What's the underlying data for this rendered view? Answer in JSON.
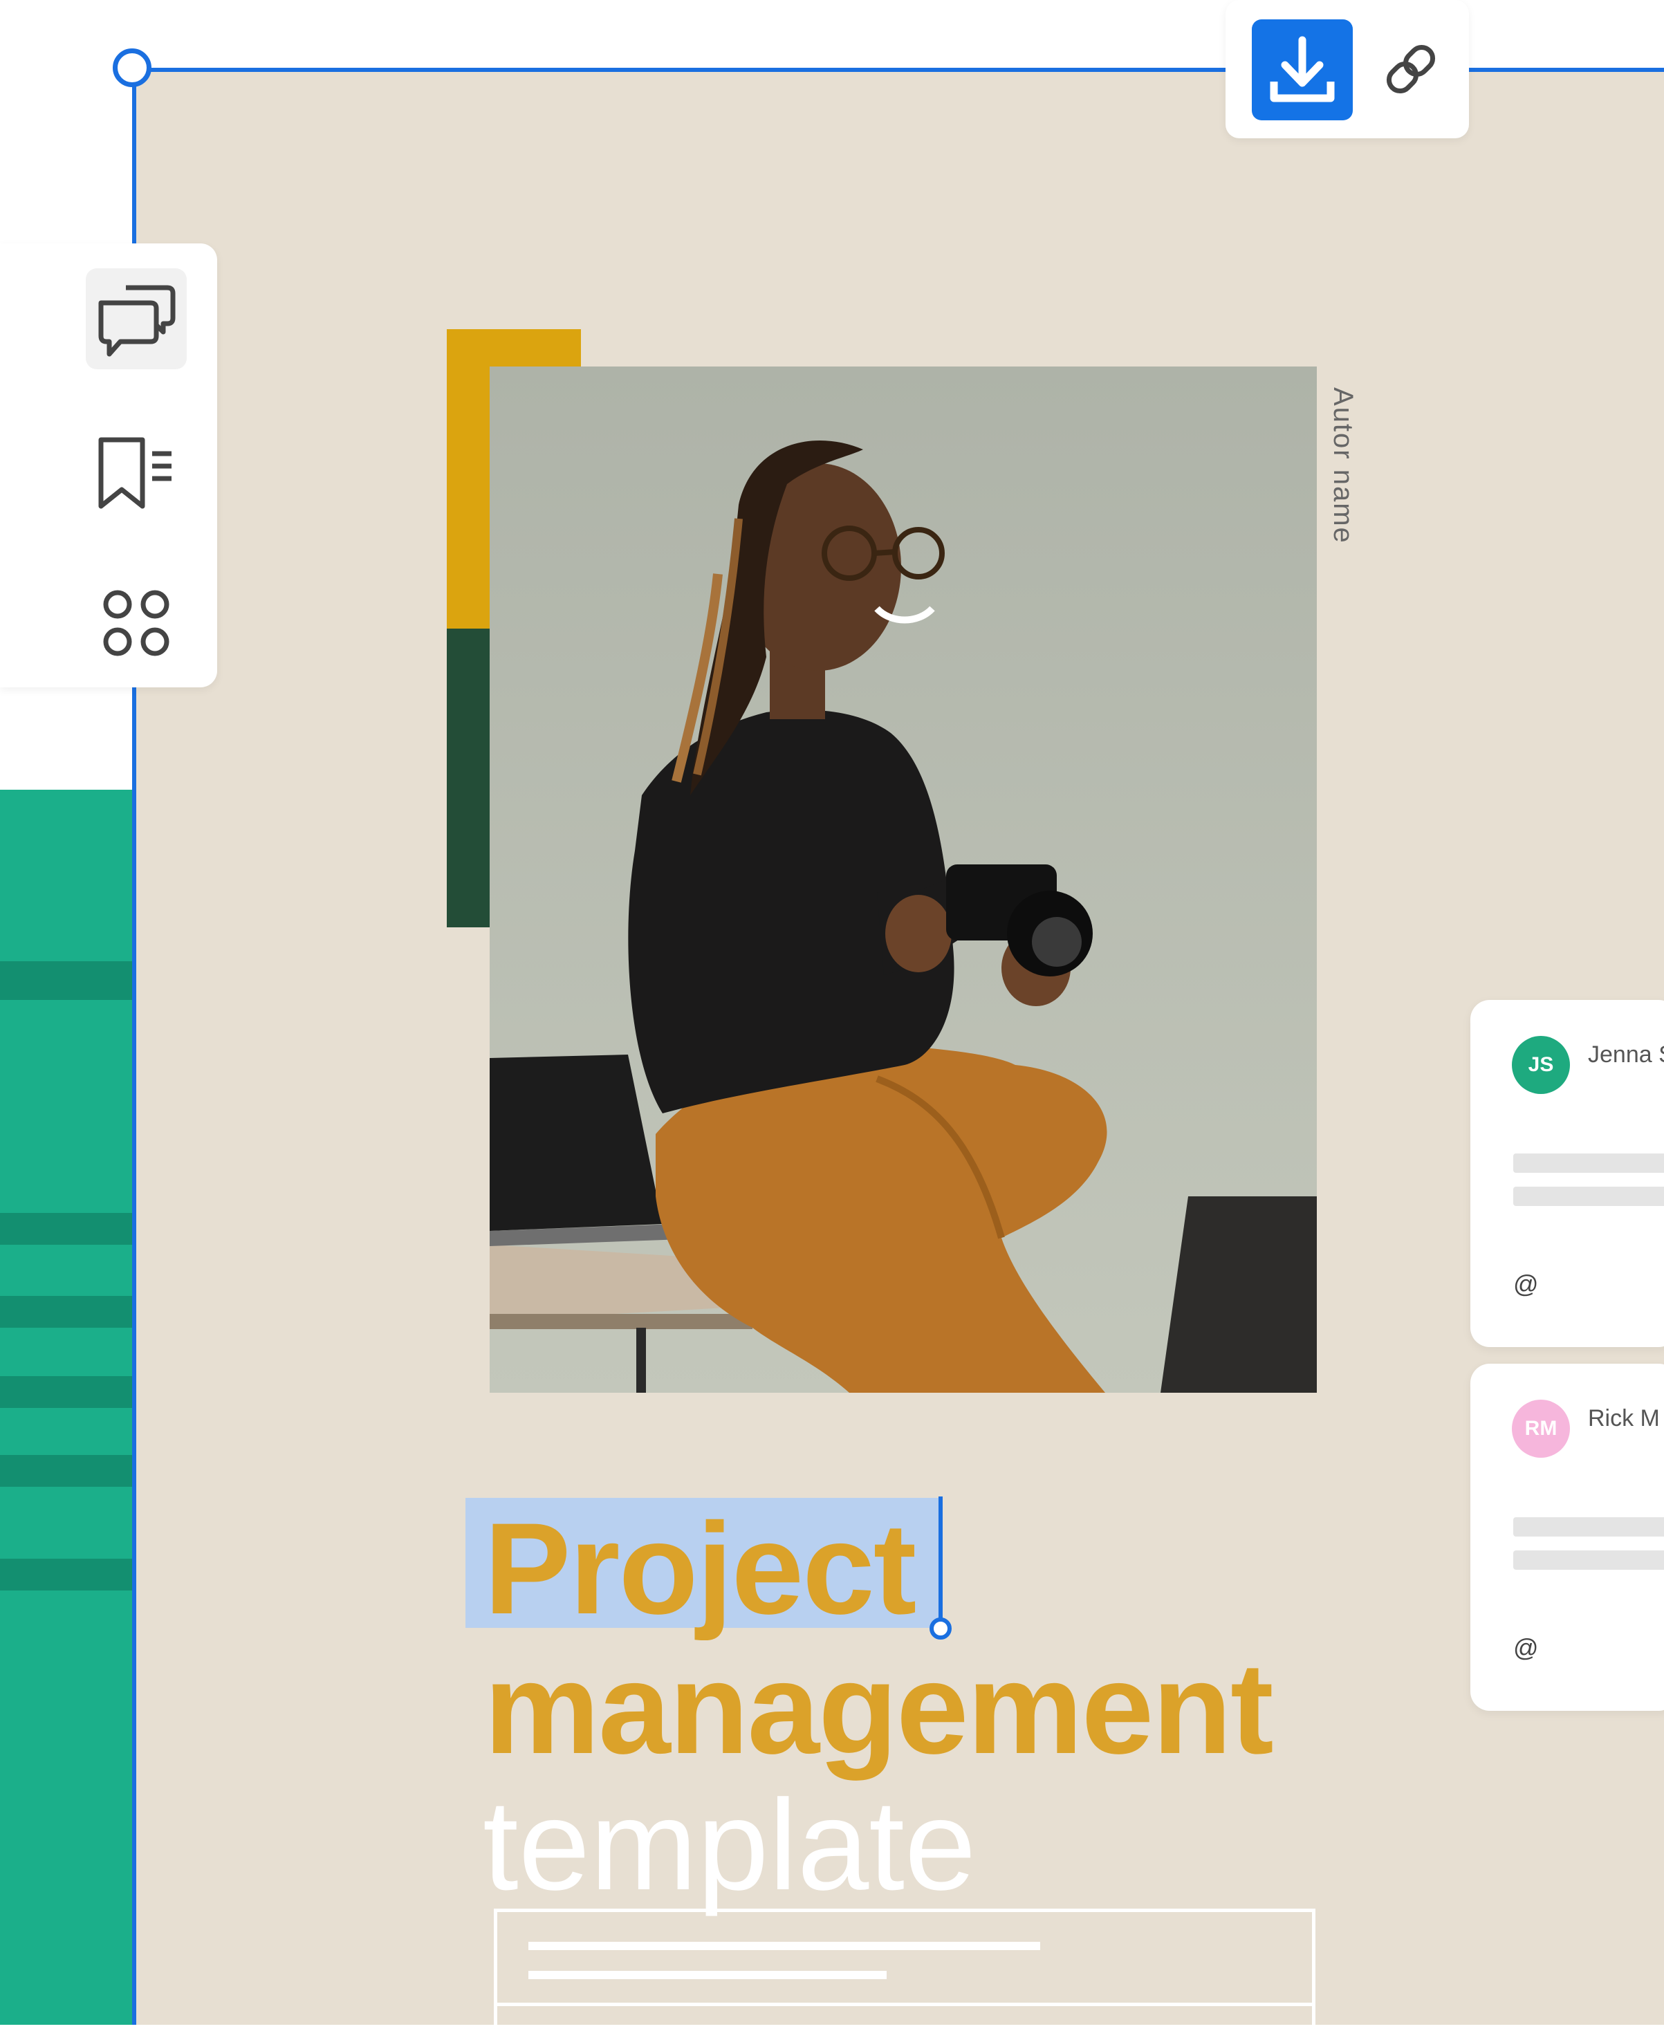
{
  "toolbar": {
    "download_icon": "download-icon",
    "link_icon": "link-icon",
    "accent_color": "#1473e6"
  },
  "side_rail": {
    "items": [
      {
        "icon": "comments-icon",
        "active": true
      },
      {
        "icon": "bookmarks-icon",
        "active": false
      },
      {
        "icon": "grid-icon",
        "active": false
      }
    ]
  },
  "document": {
    "author_label": "Autor name",
    "title_line_1": "Project",
    "title_line_2": "management",
    "title_line_3": "template",
    "colors": {
      "background": "#e7dfd2",
      "title": "#dba22a",
      "accent_yellow": "#dba40f",
      "accent_green": "#234d37",
      "selection": "#b8d0f0"
    }
  },
  "comments": [
    {
      "initials": "JS",
      "name": "Jenna S",
      "avatar_color": "#1eaa7f",
      "mention": "@"
    },
    {
      "initials": "RM",
      "name": "Rick M",
      "avatar_color": "#f6b6dc",
      "mention": "@"
    }
  ]
}
